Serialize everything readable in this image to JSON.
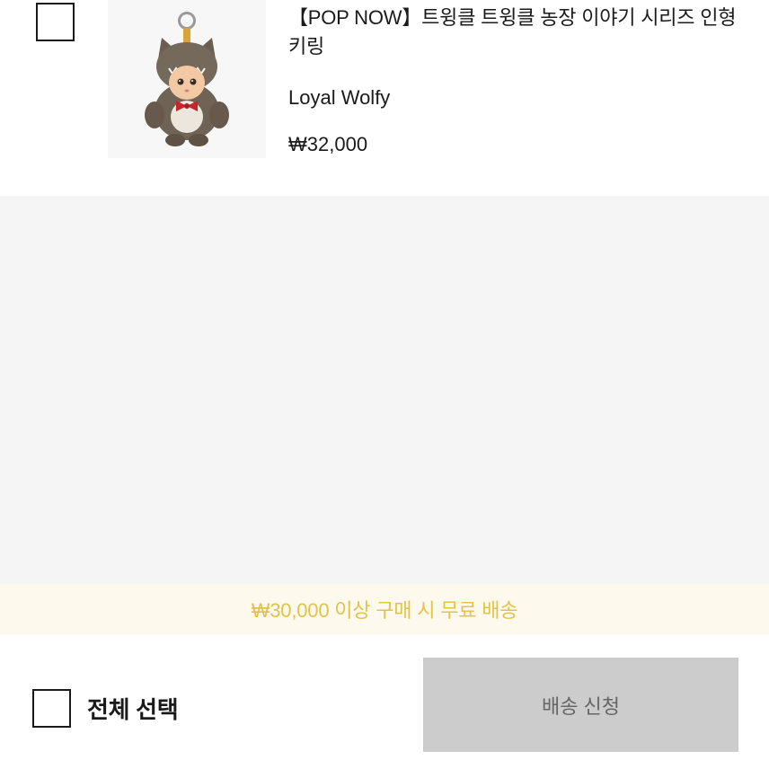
{
  "cart": {
    "item": {
      "title": "【POP NOW】트윙클 트윙클 농장 이야기 시리즈 인형 키링",
      "option": "Loyal Wolfy",
      "price": "₩32,000",
      "image_icon": "wolfy-keyring-image"
    }
  },
  "shipping_notice": "₩30,000 이상 구매 시 무료 배송",
  "footer": {
    "select_all_label": "전체 선택",
    "ship_button_label": "배송 신청"
  },
  "colors": {
    "notice_text": "#e3c24a",
    "notice_bg": "#fdf9ec",
    "button_bg": "#cccccc",
    "page_bg": "#f5f5f5"
  }
}
